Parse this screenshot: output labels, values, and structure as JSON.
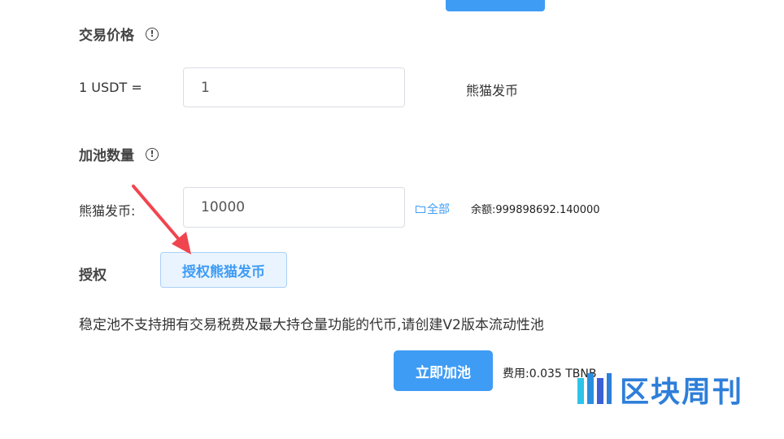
{
  "price_section": {
    "title": "交易价格",
    "row_label": "1 USDT =",
    "input_value": "1",
    "unit": "熊猫发币"
  },
  "pool_section": {
    "title": "加池数量",
    "row_label": "熊猫发币:",
    "input_value": "10000",
    "all_link": "全部",
    "balance": "余额:999898692.140000"
  },
  "auth_section": {
    "label": "授权",
    "button_label": "授权熊猫发币"
  },
  "notice": "稳定池不支持拥有交易税费及最大持仓量功能的代币,请创建V2版本流动性池",
  "submit": {
    "button_label": "立即加池",
    "fee": "费用:0.035 TBNB"
  },
  "watermark": {
    "text": "区块周刊"
  },
  "colors": {
    "primary": "#3f9cf5",
    "arrow": "#f0454f"
  }
}
